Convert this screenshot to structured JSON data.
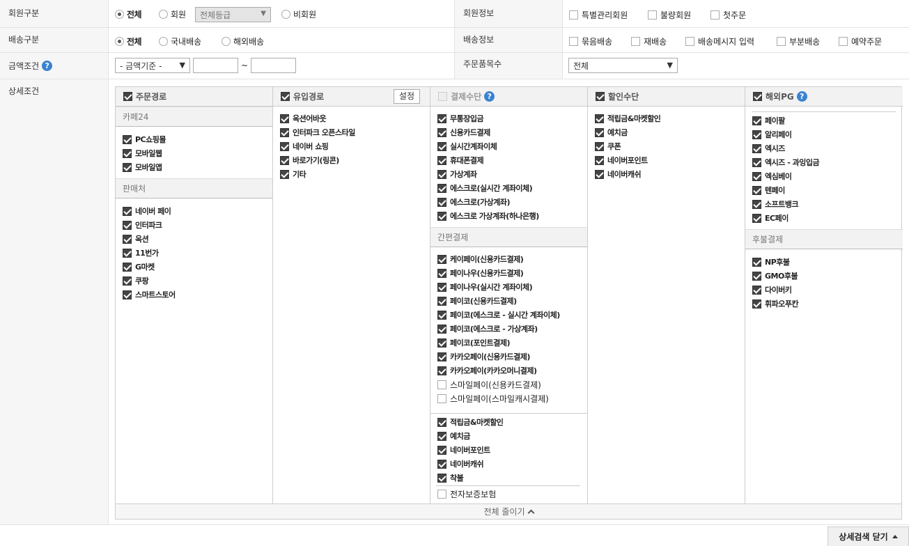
{
  "member": {
    "label": "회원구분",
    "options": [
      "전체",
      "회원",
      "비회원"
    ],
    "grade_select": "전체등급"
  },
  "member_info": {
    "label": "회원정보",
    "options": [
      "특별관리회원",
      "불량회원",
      "첫주문"
    ]
  },
  "shipping": {
    "label": "배송구분",
    "options": [
      "전체",
      "국내배송",
      "해외배송"
    ]
  },
  "shipping_info": {
    "label": "배송정보",
    "options": [
      "묶음배송",
      "재배송",
      "배송메시지 입력",
      "부분배송",
      "예약주문"
    ]
  },
  "amount": {
    "label": "금액조건",
    "select": "- 금액기준 -",
    "tilde": "~"
  },
  "item_count": {
    "label": "주문품목수",
    "select": "전체"
  },
  "detail": {
    "label": "상세조건",
    "order_path": {
      "title": "주문경로",
      "cafe24_label": "카페24",
      "cafe24_items": [
        "PC쇼핑몰",
        "모바일웹",
        "모바일앱"
      ],
      "seller_label": "판매처",
      "seller_items": [
        "네이버 페이",
        "인터파크",
        "옥션",
        "11번가",
        "G마켓",
        "쿠팡",
        "스마트스토어"
      ]
    },
    "inflow": {
      "title": "유입경로",
      "settings_button": "설정",
      "items": [
        "옥션어바웃",
        "인터파크 오픈스타일",
        "네이버 쇼핑",
        "바로가기(링콘)",
        "기타"
      ]
    },
    "payment": {
      "title": "결제수단",
      "items": [
        "무통장입금",
        "신용카드결제",
        "실시간계좌이체",
        "휴대폰결제",
        "가상계좌",
        "에스크로(실시간 계좌이체)",
        "에스크로(가상계좌)",
        "에스크로 가상계좌(하나은행)"
      ],
      "easy_label": "간편결제",
      "easy_items": [
        "케이페이(신용카드결제)",
        "페이나우(신용카드결제)",
        "페이나우(실시간 계좌이체)",
        "페이코(신용카드결제)",
        "페이코(에스크로 - 실시간 계좌이체)",
        "페이코(에스크로 - 가상계좌)",
        "페이코(포인트결제)",
        "카카오페이(신용카드결제)",
        "카카오페이(카카오머니결제)"
      ],
      "easy_unchecked": [
        "스마일페이(신용카드결제)",
        "스마일페이(스마일캐시결제)"
      ],
      "extra_items": [
        "적립금&마켓할인",
        "예치금",
        "네이버포인트",
        "네이버캐쉬",
        "착불"
      ],
      "extra_unchecked": "전자보증보험"
    },
    "discount": {
      "title": "할인수단",
      "items": [
        "적립금&마켓할인",
        "예치금",
        "쿠폰",
        "네이버포인트",
        "네이버캐쉬"
      ]
    },
    "overseas_pg": {
      "title": "해외PG",
      "items": [
        "페이팔",
        "알리페이",
        "엑시즈",
        "엑시즈 - 과잉입금",
        "엑심베이",
        "텐페이",
        "소프트뱅크",
        "EC페이"
      ],
      "deferred_label": "후불결제",
      "deferred_items": [
        "NP후불",
        "GMO후불",
        "다이버키",
        "휘파오푸칸"
      ]
    },
    "collapse_all": "전체 줄이기"
  },
  "close_detail_button": "상세검색 닫기"
}
